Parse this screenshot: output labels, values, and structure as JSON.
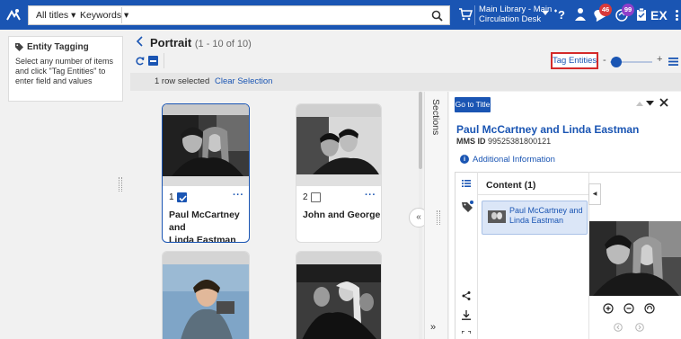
{
  "colors": {
    "brand_blue": "#1a55b3",
    "highlight_red": "#d42a2a",
    "selected_bg": "#dbe6f7"
  },
  "header": {
    "scope_dropdown": "All titles ▾",
    "search_field_dropdown": "Keywords ▾",
    "search_value": "",
    "location_line1": "Main Library - Main",
    "location_line2": "Circulation Desk",
    "notification_count_red": "46",
    "notification_count_purple": "99",
    "user_initials": "EX"
  },
  "info_panel": {
    "title": "Entity Tagging",
    "body": "Select any number of items and click \"Tag Entities\" to enter field and values"
  },
  "gallery": {
    "title": "Portrait",
    "count": "(1 - 10 of 10)",
    "tag_entities_label": "Tag Entities",
    "slider_minus": "-",
    "slider_plus": "+",
    "selection_text": "1 row selected",
    "clear_selection_label": "Clear Selection",
    "items": [
      {
        "number": "1",
        "checked": true,
        "title_line1": "Paul McCartney and",
        "title_line2": "Linda Eastman"
      },
      {
        "number": "2",
        "checked": false,
        "title_line1": "John and George",
        "title_line2": ""
      },
      {
        "number": "",
        "checked": false,
        "title_line1": "",
        "title_line2": ""
      },
      {
        "number": "",
        "checked": false,
        "title_line1": "",
        "title_line2": ""
      }
    ],
    "more_label": "···"
  },
  "sections_label": "Sections",
  "detail": {
    "goto_title_label": "Go to Title",
    "title": "Paul McCartney and Linda Eastman",
    "mms_label": "MMS ID",
    "mms_id": "99525381800121",
    "additional_info_label": "Additional Information",
    "content_header": "Content (1)",
    "content_item_line1": "Paul McCartney and",
    "content_item_line2": "Linda Eastman"
  },
  "icons": [
    "logo-icon",
    "home-icon",
    "search-icon",
    "cart-icon",
    "help-icon",
    "user-icon",
    "notification-icon",
    "announcement-icon",
    "tasks-icon",
    "refresh-icon",
    "list-view-icon",
    "back-icon",
    "tag-icon",
    "close-icon",
    "share-icon",
    "download-icon",
    "zoom-in-icon",
    "zoom-out-icon",
    "rotate-icon"
  ]
}
